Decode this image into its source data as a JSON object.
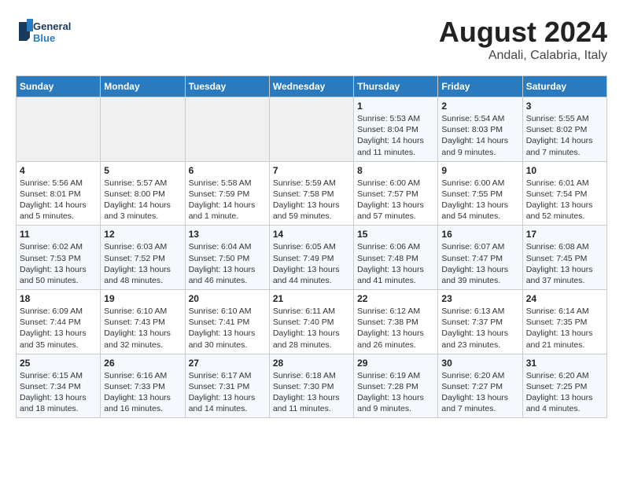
{
  "header": {
    "logo_line1": "General",
    "logo_line2": "Blue",
    "title": "August 2024",
    "subtitle": "Andali, Calabria, Italy"
  },
  "calendar": {
    "days_of_week": [
      "Sunday",
      "Monday",
      "Tuesday",
      "Wednesday",
      "Thursday",
      "Friday",
      "Saturday"
    ],
    "weeks": [
      [
        {
          "day": "",
          "info": ""
        },
        {
          "day": "",
          "info": ""
        },
        {
          "day": "",
          "info": ""
        },
        {
          "day": "",
          "info": ""
        },
        {
          "day": "1",
          "info": "Sunrise: 5:53 AM\nSunset: 8:04 PM\nDaylight: 14 hours\nand 11 minutes."
        },
        {
          "day": "2",
          "info": "Sunrise: 5:54 AM\nSunset: 8:03 PM\nDaylight: 14 hours\nand 9 minutes."
        },
        {
          "day": "3",
          "info": "Sunrise: 5:55 AM\nSunset: 8:02 PM\nDaylight: 14 hours\nand 7 minutes."
        }
      ],
      [
        {
          "day": "4",
          "info": "Sunrise: 5:56 AM\nSunset: 8:01 PM\nDaylight: 14 hours\nand 5 minutes."
        },
        {
          "day": "5",
          "info": "Sunrise: 5:57 AM\nSunset: 8:00 PM\nDaylight: 14 hours\nand 3 minutes."
        },
        {
          "day": "6",
          "info": "Sunrise: 5:58 AM\nSunset: 7:59 PM\nDaylight: 14 hours\nand 1 minute."
        },
        {
          "day": "7",
          "info": "Sunrise: 5:59 AM\nSunset: 7:58 PM\nDaylight: 13 hours\nand 59 minutes."
        },
        {
          "day": "8",
          "info": "Sunrise: 6:00 AM\nSunset: 7:57 PM\nDaylight: 13 hours\nand 57 minutes."
        },
        {
          "day": "9",
          "info": "Sunrise: 6:00 AM\nSunset: 7:55 PM\nDaylight: 13 hours\nand 54 minutes."
        },
        {
          "day": "10",
          "info": "Sunrise: 6:01 AM\nSunset: 7:54 PM\nDaylight: 13 hours\nand 52 minutes."
        }
      ],
      [
        {
          "day": "11",
          "info": "Sunrise: 6:02 AM\nSunset: 7:53 PM\nDaylight: 13 hours\nand 50 minutes."
        },
        {
          "day": "12",
          "info": "Sunrise: 6:03 AM\nSunset: 7:52 PM\nDaylight: 13 hours\nand 48 minutes."
        },
        {
          "day": "13",
          "info": "Sunrise: 6:04 AM\nSunset: 7:50 PM\nDaylight: 13 hours\nand 46 minutes."
        },
        {
          "day": "14",
          "info": "Sunrise: 6:05 AM\nSunset: 7:49 PM\nDaylight: 13 hours\nand 44 minutes."
        },
        {
          "day": "15",
          "info": "Sunrise: 6:06 AM\nSunset: 7:48 PM\nDaylight: 13 hours\nand 41 minutes."
        },
        {
          "day": "16",
          "info": "Sunrise: 6:07 AM\nSunset: 7:47 PM\nDaylight: 13 hours\nand 39 minutes."
        },
        {
          "day": "17",
          "info": "Sunrise: 6:08 AM\nSunset: 7:45 PM\nDaylight: 13 hours\nand 37 minutes."
        }
      ],
      [
        {
          "day": "18",
          "info": "Sunrise: 6:09 AM\nSunset: 7:44 PM\nDaylight: 13 hours\nand 35 minutes."
        },
        {
          "day": "19",
          "info": "Sunrise: 6:10 AM\nSunset: 7:43 PM\nDaylight: 13 hours\nand 32 minutes."
        },
        {
          "day": "20",
          "info": "Sunrise: 6:10 AM\nSunset: 7:41 PM\nDaylight: 13 hours\nand 30 minutes."
        },
        {
          "day": "21",
          "info": "Sunrise: 6:11 AM\nSunset: 7:40 PM\nDaylight: 13 hours\nand 28 minutes."
        },
        {
          "day": "22",
          "info": "Sunrise: 6:12 AM\nSunset: 7:38 PM\nDaylight: 13 hours\nand 26 minutes."
        },
        {
          "day": "23",
          "info": "Sunrise: 6:13 AM\nSunset: 7:37 PM\nDaylight: 13 hours\nand 23 minutes."
        },
        {
          "day": "24",
          "info": "Sunrise: 6:14 AM\nSunset: 7:35 PM\nDaylight: 13 hours\nand 21 minutes."
        }
      ],
      [
        {
          "day": "25",
          "info": "Sunrise: 6:15 AM\nSunset: 7:34 PM\nDaylight: 13 hours\nand 18 minutes."
        },
        {
          "day": "26",
          "info": "Sunrise: 6:16 AM\nSunset: 7:33 PM\nDaylight: 13 hours\nand 16 minutes."
        },
        {
          "day": "27",
          "info": "Sunrise: 6:17 AM\nSunset: 7:31 PM\nDaylight: 13 hours\nand 14 minutes."
        },
        {
          "day": "28",
          "info": "Sunrise: 6:18 AM\nSunset: 7:30 PM\nDaylight: 13 hours\nand 11 minutes."
        },
        {
          "day": "29",
          "info": "Sunrise: 6:19 AM\nSunset: 7:28 PM\nDaylight: 13 hours\nand 9 minutes."
        },
        {
          "day": "30",
          "info": "Sunrise: 6:20 AM\nSunset: 7:27 PM\nDaylight: 13 hours\nand 7 minutes."
        },
        {
          "day": "31",
          "info": "Sunrise: 6:20 AM\nSunset: 7:25 PM\nDaylight: 13 hours\nand 4 minutes."
        }
      ]
    ]
  }
}
